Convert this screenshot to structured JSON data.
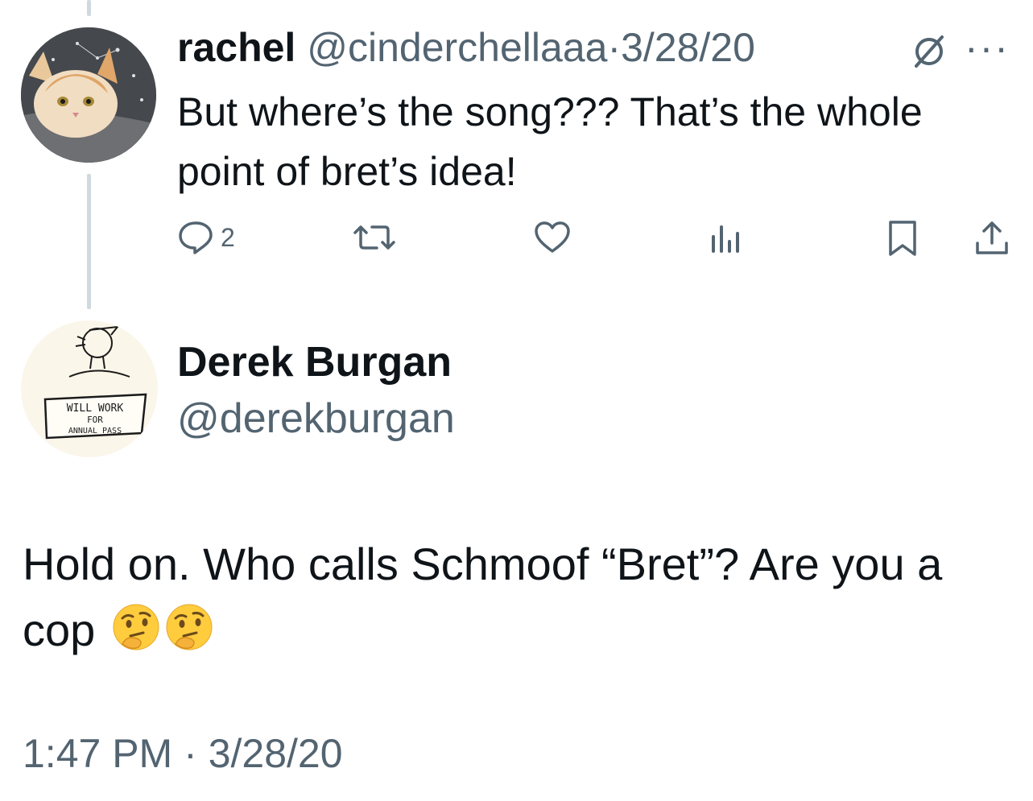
{
  "reply": {
    "display_name": "rachel",
    "handle": "@cinderchellaaa",
    "separator": "·",
    "date": "3/28/20",
    "more": "···",
    "text": "But where’s the song??? That’s the whole point of bret’s idea!",
    "avatar_icon": "cat-photo-avatar",
    "actions": {
      "reply_count": "2",
      "reply_icon": "comment-icon",
      "retweet_icon": "retweet-icon",
      "like_icon": "heart-icon",
      "views_icon": "analytics-icon",
      "bookmark_icon": "bookmark-icon",
      "share_icon": "share-icon"
    }
  },
  "main_tweet": {
    "display_name": "Derek Burgan",
    "handle": "@derekburgan",
    "text": "Hold on. Who calls Schmoof “Bret”? Are you a cop",
    "emojis": [
      "🤔",
      "🤔"
    ],
    "avatar_sign_lines": [
      "WILL WORK",
      "FOR",
      "ANNUAL PASS"
    ],
    "time": "1:47 PM",
    "separator": "·",
    "date": "3/28/20"
  },
  "colors": {
    "text": "#0f1419",
    "muted": "#536471",
    "thread_line": "#cfd9de"
  }
}
